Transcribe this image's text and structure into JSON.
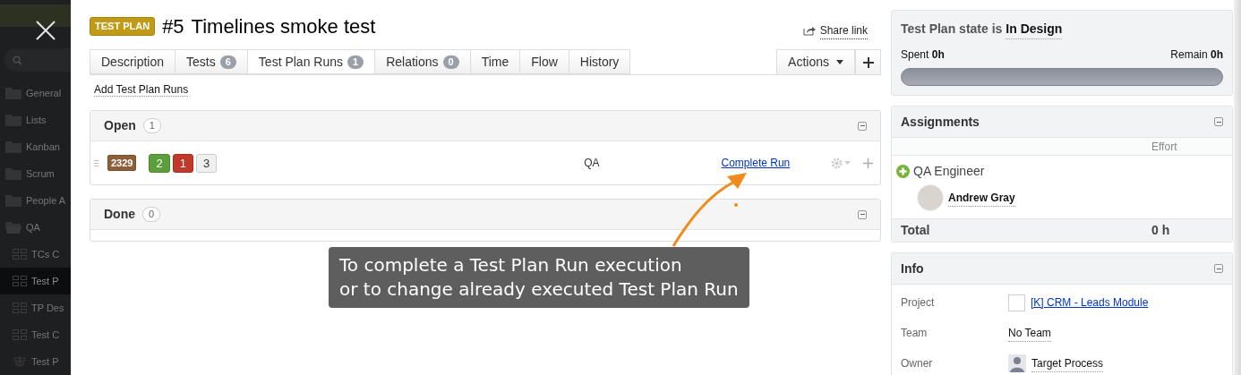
{
  "sidebar": {
    "items": [
      {
        "label": "General",
        "kind": "folder",
        "selected": false
      },
      {
        "label": "Lists",
        "kind": "folder",
        "selected": false
      },
      {
        "label": "Kanban",
        "kind": "folder",
        "selected": false
      },
      {
        "label": "Scrum",
        "kind": "folder",
        "selected": false
      },
      {
        "label": "People A",
        "kind": "folder",
        "selected": false
      },
      {
        "label": "QA",
        "kind": "open-folder",
        "selected": false
      },
      {
        "label": "TCs C",
        "kind": "view",
        "selected": false
      },
      {
        "label": "Test P",
        "kind": "view",
        "selected": true
      },
      {
        "label": "TP Des",
        "kind": "view",
        "selected": false
      },
      {
        "label": "Test C",
        "kind": "view",
        "selected": false
      },
      {
        "label": "Test P",
        "kind": "flow",
        "selected": false
      }
    ]
  },
  "entity": {
    "type_badge": "TEST PLAN",
    "number": "#5",
    "title": "Timelines smoke test",
    "share_link": "Share link"
  },
  "tabs": [
    {
      "label": "Description",
      "selected": false
    },
    {
      "label": "Tests",
      "count": "6",
      "selected": false
    },
    {
      "label": "Test Plan Runs",
      "count": "1",
      "selected": true
    },
    {
      "label": "Relations",
      "count": "0",
      "selected": false
    },
    {
      "label": "Time",
      "selected": false
    },
    {
      "label": "Flow",
      "selected": false
    },
    {
      "label": "History",
      "selected": false
    }
  ],
  "actions_button": "Actions",
  "add_link": "Add Test Plan Runs",
  "sections": [
    {
      "title": "Open",
      "count": "1",
      "rows": [
        {
          "id": "2329",
          "passed": "2",
          "failed": "1",
          "other": "3",
          "team": "QA",
          "action": "Complete Run"
        }
      ]
    },
    {
      "title": "Done",
      "count": "0"
    }
  ],
  "callout": {
    "lines": [
      "To complete a Test Plan Run execution",
      "or to change already executed Test Plan Run"
    ]
  },
  "state_panel": {
    "label": "Test Plan state is",
    "state": "In Design",
    "spent_label": "Spent",
    "spent": "0h",
    "remain_label": "Remain",
    "remain": "0h",
    "level": 0
  },
  "assignments": {
    "title": "Assignments",
    "effort_header": "Effort",
    "role": "QA Engineer",
    "person": "Andrew Gray",
    "total_label": "Total",
    "total": "0 h"
  },
  "info": {
    "title": "Info",
    "fields": [
      {
        "label": "Project",
        "value": "[K] CRM - Leads Module",
        "kind": "project"
      },
      {
        "label": "Team",
        "value": "No Team",
        "kind": "plain"
      },
      {
        "label": "Owner",
        "value": "Target Process",
        "kind": "user"
      }
    ]
  }
}
